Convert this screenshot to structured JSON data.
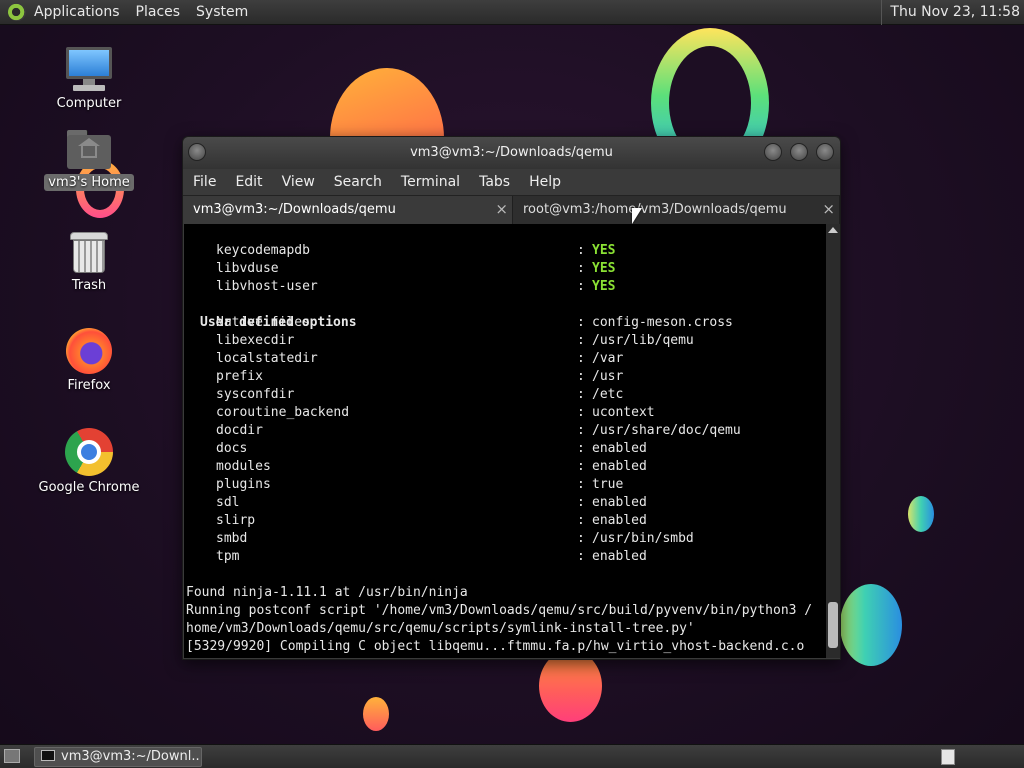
{
  "top_panel": {
    "menus": [
      "Applications",
      "Places",
      "System"
    ],
    "clock": "Thu Nov 23, 11:58"
  },
  "desktop_icons": [
    {
      "label": "Computer",
      "icon": "computer-icon"
    },
    {
      "label": "vm3's Home",
      "icon": "home-folder-icon",
      "selected": true
    },
    {
      "label": "Trash",
      "icon": "trash-icon"
    },
    {
      "label": "Firefox",
      "icon": "firefox-icon"
    },
    {
      "label": "Google Chrome",
      "icon": "chrome-icon"
    }
  ],
  "window": {
    "title": "vm3@vm3:~/Downloads/qemu",
    "menu": [
      "File",
      "Edit",
      "View",
      "Search",
      "Terminal",
      "Tabs",
      "Help"
    ],
    "tabs": [
      {
        "label": "vm3@vm3:~/Downloads/qemu",
        "active": true
      },
      {
        "label": "root@vm3:/home/vm3/Downloads/qemu",
        "active": false
      }
    ],
    "close_glyph": "×"
  },
  "terminal": {
    "top_options": [
      {
        "name": "keycodemapdb",
        "sep": ":",
        "value": "YES"
      },
      {
        "name": "libvduse",
        "sep": ":",
        "value": "YES"
      },
      {
        "name": "libvhost-user",
        "sep": ":",
        "value": "YES"
      }
    ],
    "section_title": "User defined options",
    "user_options": [
      {
        "name": "Native files",
        "sep": ":",
        "value": "config-meson.cross"
      },
      {
        "name": "libexecdir",
        "sep": ":",
        "value": "/usr/lib/qemu"
      },
      {
        "name": "localstatedir",
        "sep": ":",
        "value": "/var"
      },
      {
        "name": "prefix",
        "sep": ":",
        "value": "/usr"
      },
      {
        "name": "sysconfdir",
        "sep": ":",
        "value": "/etc"
      },
      {
        "name": "coroutine_backend",
        "sep": ":",
        "value": "ucontext"
      },
      {
        "name": "docdir",
        "sep": ":",
        "value": "/usr/share/doc/qemu"
      },
      {
        "name": "docs",
        "sep": ":",
        "value": "enabled"
      },
      {
        "name": "modules",
        "sep": ":",
        "value": "enabled"
      },
      {
        "name": "plugins",
        "sep": ":",
        "value": "true"
      },
      {
        "name": "sdl",
        "sep": ":",
        "value": "enabled"
      },
      {
        "name": "slirp",
        "sep": ":",
        "value": "enabled"
      },
      {
        "name": "smbd",
        "sep": ":",
        "value": "/usr/bin/smbd"
      },
      {
        "name": "tpm",
        "sep": ":",
        "value": "enabled"
      }
    ],
    "log_lines": [
      "Found ninja-1.11.1 at /usr/bin/ninja",
      "Running postconf script '/home/vm3/Downloads/qemu/src/build/pyvenv/bin/python3 /",
      "home/vm3/Downloads/qemu/src/qemu/scripts/symlink-install-tree.py'",
      "[5329/9920] Compiling C object libqemu...ftmmu.fa.p/hw_virtio_vhost-backend.c.o"
    ]
  },
  "taskbar": {
    "task_label": "vm3@vm3:~/Downl..."
  },
  "colors": {
    "yes": "#8be234",
    "terminal_bg": "#000000",
    "panel_bg": "#333333"
  }
}
